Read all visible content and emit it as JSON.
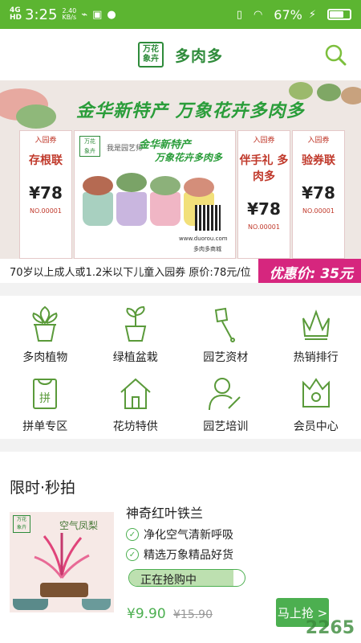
{
  "status_bar": {
    "network": "4G",
    "network_sub": "HD",
    "time": "3:25",
    "speed_value": "2.40",
    "speed_unit": "KB/s",
    "battery": "67%",
    "battery_level": 0.67
  },
  "header": {
    "logo_text_line1": "万花",
    "logo_text_line2": "象卉",
    "title": "多肉多"
  },
  "banner": {
    "headline": "金华新特产 万象花卉多肉多",
    "ticket_main_headline": "金华新特产",
    "ticket_main_sub": "万象花卉多肉多",
    "ticket_main_tag": "我是园艺师",
    "ticket_main_url": "www.duorou.com",
    "ticket_main_shop": "多肉多商城",
    "stubs": [
      {
        "top": "入园券",
        "title": "存根联",
        "price": "¥78",
        "no": "NO.00001"
      },
      {
        "top": "入园券",
        "title": "伴手礼 多肉多",
        "price": "¥78",
        "no": "NO.00001"
      },
      {
        "top": "入园券",
        "title": "验券联",
        "price": "¥78",
        "no": "NO.00001"
      }
    ],
    "description": "70岁以上成人或1.2米以下儿童入园券 原价:78元/位",
    "deal_text": "优惠价: 35元"
  },
  "categories": [
    {
      "label": "多肉植物",
      "icon": "succulent-pot-icon"
    },
    {
      "label": "绿植盆栽",
      "icon": "sprout-pot-icon"
    },
    {
      "label": "园艺资材",
      "icon": "shovel-icon"
    },
    {
      "label": "热销排行",
      "icon": "crown-icon"
    },
    {
      "label": "拼单专区",
      "icon": "group-bag-icon"
    },
    {
      "label": "花坊特供",
      "icon": "house-icon"
    },
    {
      "label": "园艺培训",
      "icon": "person-edit-icon"
    },
    {
      "label": "会员中心",
      "icon": "member-crown-box-icon"
    }
  ],
  "flash_sale": {
    "title": "限时·秒拍",
    "product_name": "神奇红叶铁兰",
    "thumb_caption": "空气凤梨",
    "features": [
      "净化空气清新呼吸",
      "精选万象精品好货"
    ],
    "progress_label": "正在抢购中",
    "progress_level": 0.9,
    "price": "¥9.90",
    "old_price": "¥15.90",
    "buy_label": "马上抢 >"
  },
  "watermark": "2265",
  "colors": {
    "status_green": "#5cb531",
    "brand_green": "#2e8b3a",
    "accent_green": "#4caf50",
    "deal_magenta": "#d6267e"
  }
}
